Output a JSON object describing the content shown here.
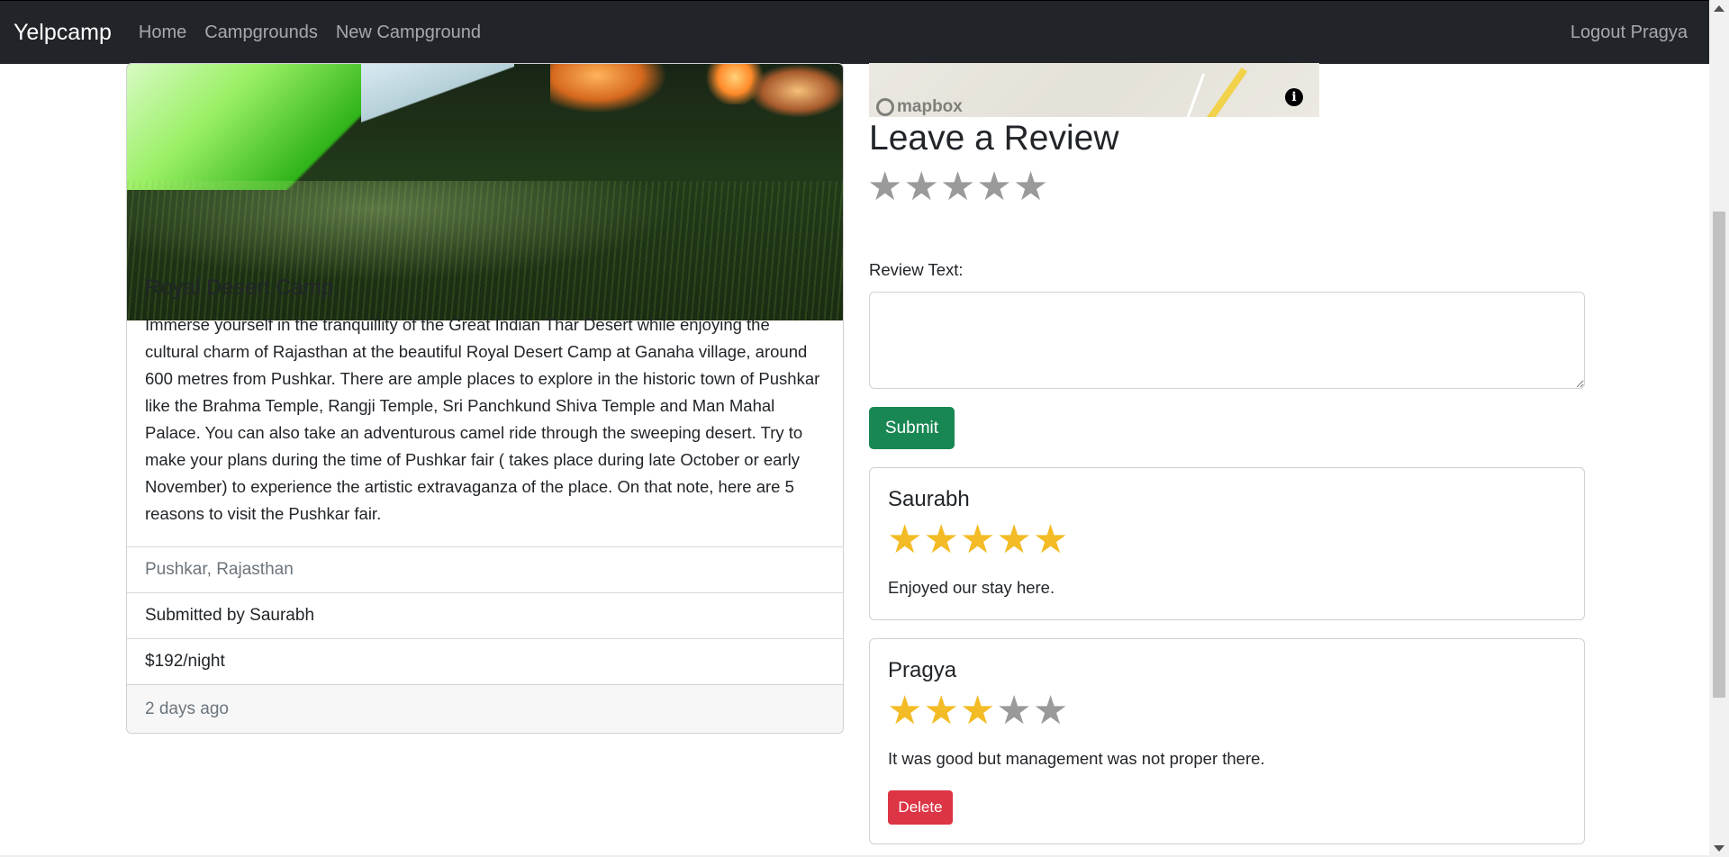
{
  "navbar": {
    "brand": "Yelpcamp",
    "links": [
      "Home",
      "Campgrounds",
      "New Campground"
    ],
    "logout": "Logout Pragya"
  },
  "campground": {
    "title": "Royal Desert Camp",
    "description": "Immerse yourself in the tranquillity of the Great Indian Thar Desert while enjoying the cultural charm of Rajasthan at the beautiful Royal Desert Camp at Ganaha village, around 600 metres from Pushkar. There are ample places to explore in the historic town of Pushkar like the Brahma Temple, Rangji Temple, Sri Panchkund Shiva Temple and Man Mahal Palace. You can also take an adventurous camel ride through the sweeping desert. Try to make your plans during the time of Pushkar fair ( takes place during late October or early November) to experience the artistic extravaganza of the place. On that note, here are 5 reasons to visit the Pushkar fair.",
    "location": "Pushkar, Rajasthan",
    "submitted_by": "Submitted by Saurabh",
    "price": "$192/night",
    "posted": "2 days ago"
  },
  "map": {
    "logo_text": "mapbox",
    "info_glyph": "i"
  },
  "review_form": {
    "heading": "Leave a Review",
    "default_rating": 0,
    "max_rating": 5,
    "label": "Review Text:",
    "textarea_value": "",
    "submit_label": "Submit"
  },
  "reviews": [
    {
      "author": "Saurabh",
      "rating": 5,
      "text": "Enjoyed our stay here.",
      "deletable": false
    },
    {
      "author": "Pragya",
      "rating": 3,
      "text": "It was good but management was not proper there.",
      "deletable": true,
      "delete_label": "Delete"
    }
  ],
  "colors": {
    "navbar_bg": "#212529",
    "submit_green": "#198754",
    "delete_red": "#dc3545",
    "star_gold": "#f3bb25",
    "star_gray": "#9a9a9a"
  },
  "icons": {
    "star": "★"
  }
}
